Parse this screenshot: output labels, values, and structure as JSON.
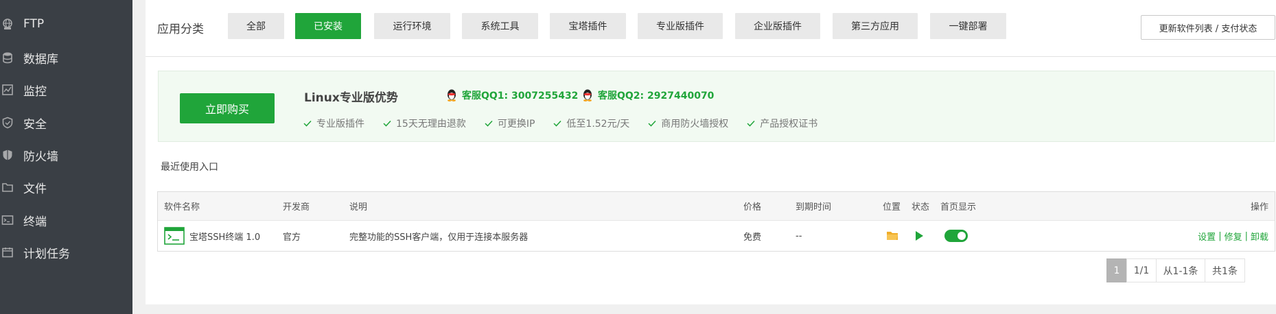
{
  "sidebar": {
    "items": [
      {
        "label": "FTP",
        "icon": "globe-icon"
      },
      {
        "label": "数据库",
        "icon": "database-icon"
      },
      {
        "label": "监控",
        "icon": "monitor-icon"
      },
      {
        "label": "安全",
        "icon": "shield-icon"
      },
      {
        "label": "防火墙",
        "icon": "firewall-icon"
      },
      {
        "label": "文件",
        "icon": "folder-icon"
      },
      {
        "label": "终端",
        "icon": "terminal-icon"
      },
      {
        "label": "计划任务",
        "icon": "calendar-icon"
      }
    ]
  },
  "categories": {
    "label": "应用分类",
    "tabs": [
      "全部",
      "已安装",
      "运行环境",
      "系统工具",
      "宝塔插件",
      "专业版插件",
      "企业版插件",
      "第三方应用",
      "一键部署"
    ],
    "active": "已安装",
    "refresh_label": "更新软件列表 / 支付状态"
  },
  "promo": {
    "buy_label": "立即购买",
    "title": "Linux专业版优势",
    "qq1": "客服QQ1: 3007255432",
    "qq2": "客服QQ2: 2927440070",
    "features": [
      "专业版插件",
      "15天无理由退款",
      "可更换IP",
      "低至1.52元/天",
      "商用防火墙授权",
      "产品授权证书"
    ]
  },
  "recent_label": "最近使用入口",
  "table": {
    "headers": {
      "name": "软件名称",
      "developer": "开发商",
      "description": "说明",
      "price": "价格",
      "expiry": "到期时间",
      "location": "位置",
      "status": "状态",
      "homepage": "首页显示",
      "actions": "操作"
    },
    "rows": [
      {
        "name": "宝塔SSH终端 1.0",
        "developer": "官方",
        "description": "完整功能的SSH客户端，仅用于连接本服务器",
        "price": "免费",
        "expiry": "--",
        "actions": {
          "settings": "设置",
          "repair": "修复",
          "uninstall": "卸载"
        }
      }
    ]
  },
  "pager": {
    "current": "1",
    "pages": "1/1",
    "range": "从1-1条",
    "total": "共1条"
  },
  "colors": {
    "accent": "#20a53a",
    "sidebar_bg": "#3a3f45"
  }
}
